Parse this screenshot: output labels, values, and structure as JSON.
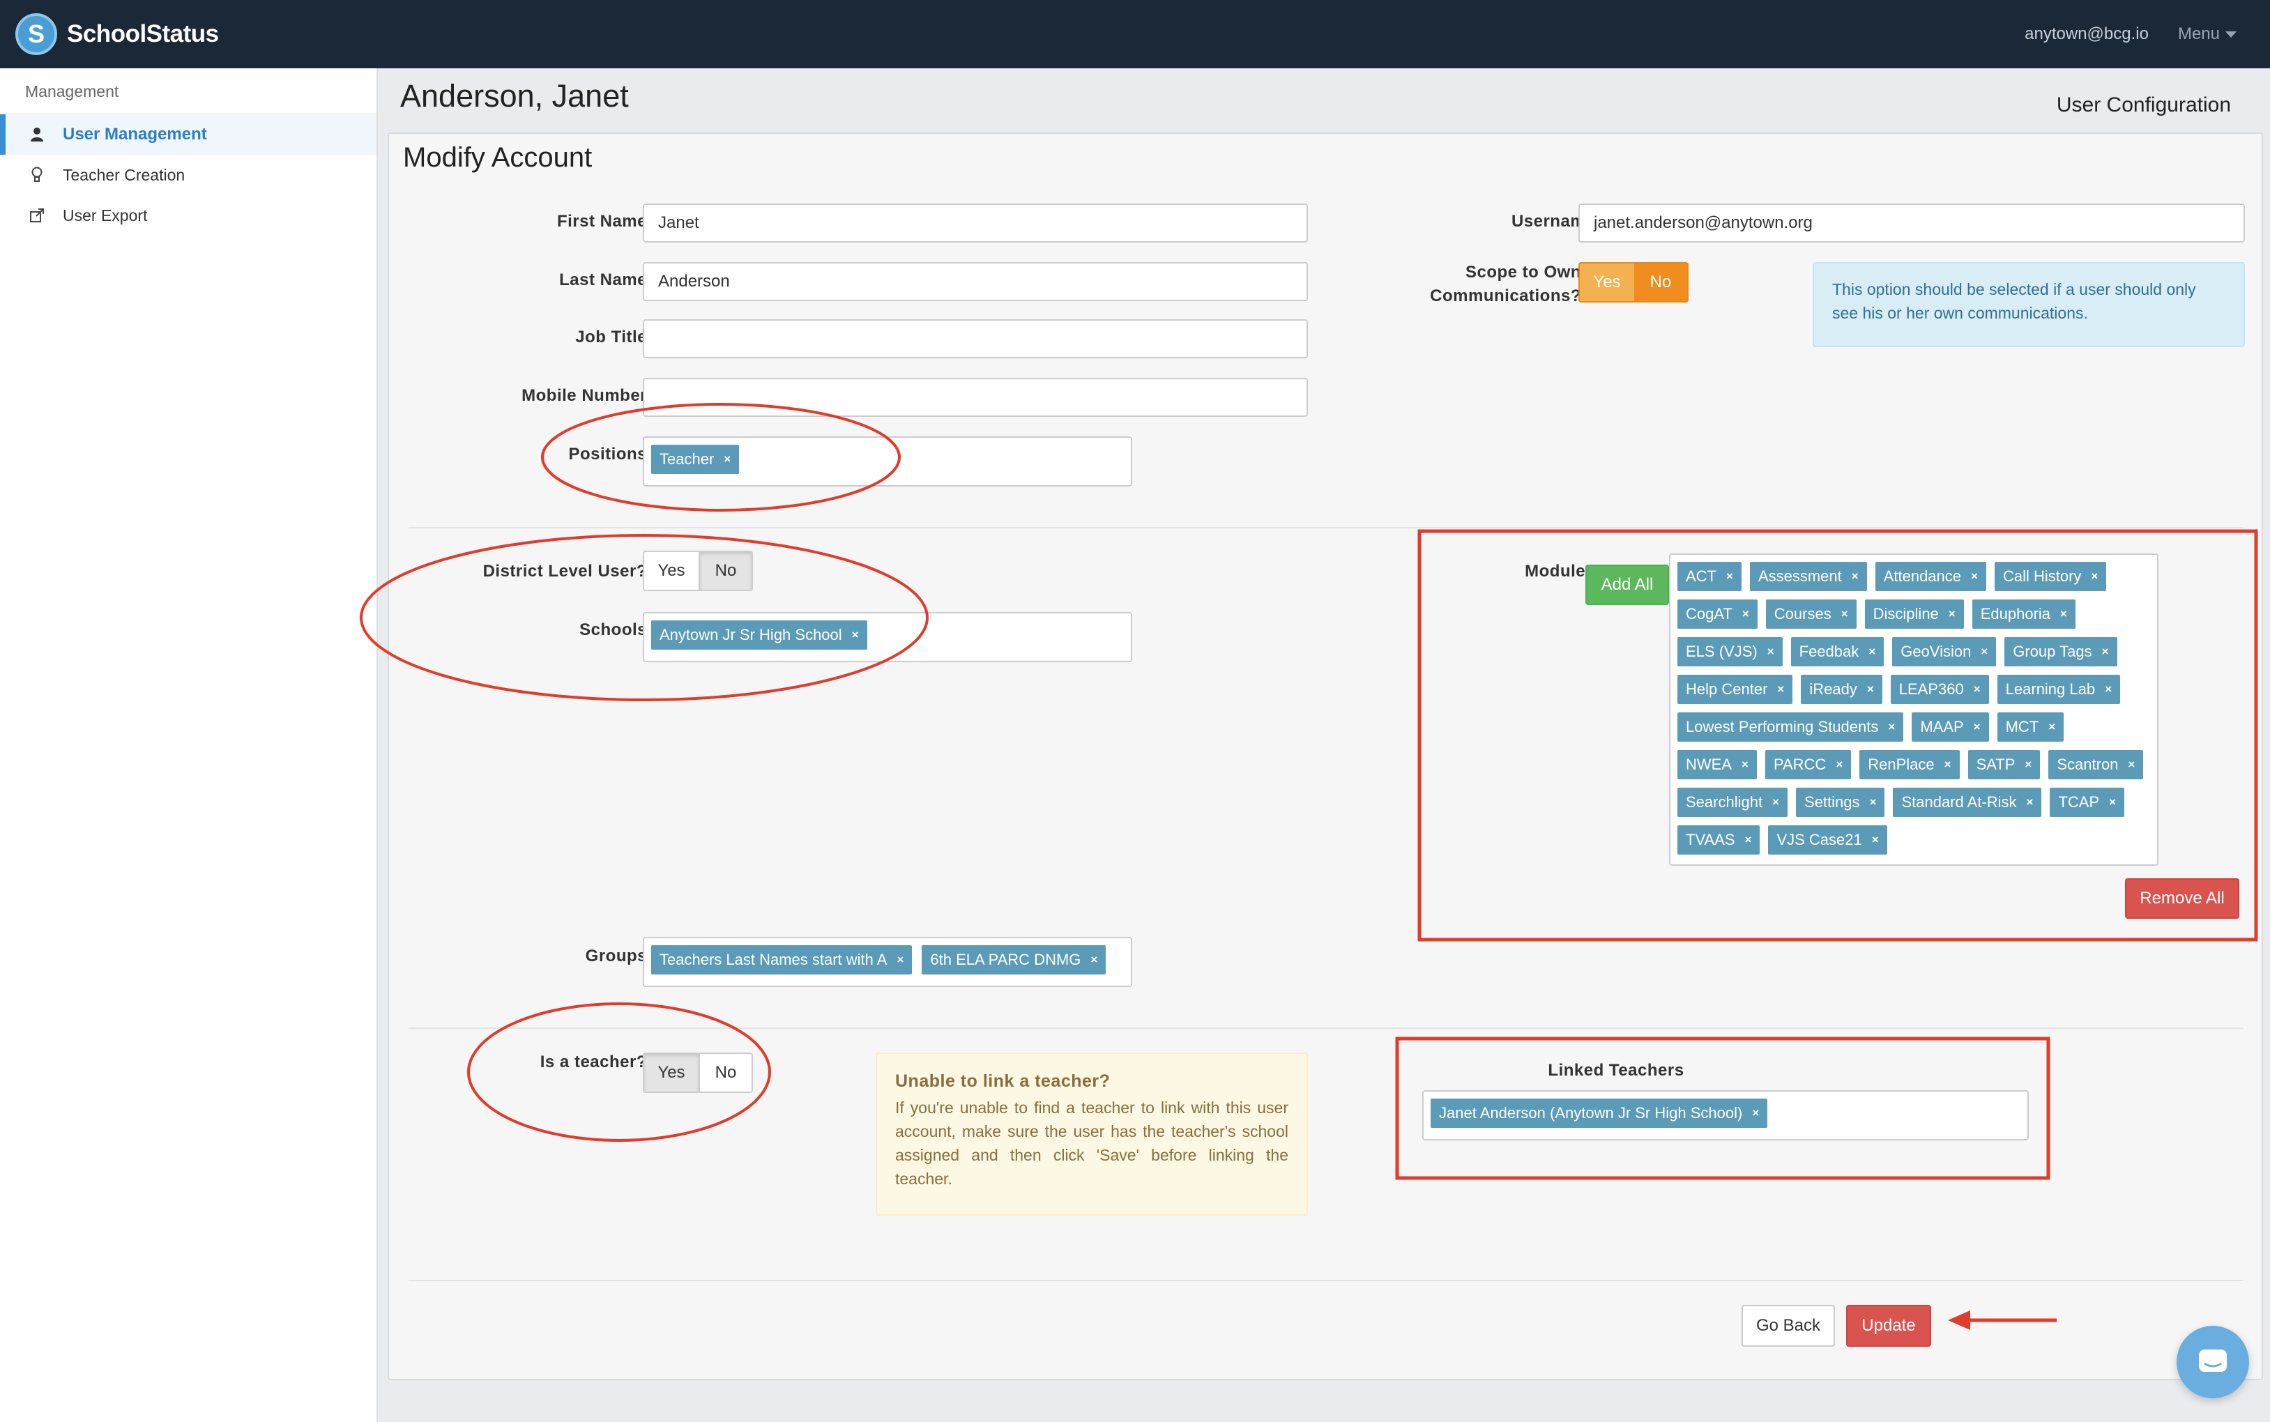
{
  "app": {
    "name": "SchoolStatus",
    "user_email": "anytown@bcg.io",
    "menu_label": "Menu"
  },
  "sidebar": {
    "section": "Management",
    "items": [
      {
        "label": "User Management",
        "icon": "user-icon",
        "active": true
      },
      {
        "label": "Teacher Creation",
        "icon": "lightbulb-icon",
        "active": false
      },
      {
        "label": "User Export",
        "icon": "external-link-icon",
        "active": false
      }
    ]
  },
  "page": {
    "title": "Anderson, Janet",
    "subtitle": "User Configuration",
    "panel_title": "Modify Account"
  },
  "form": {
    "first_name": {
      "label": "First Name",
      "value": "Janet"
    },
    "last_name": {
      "label": "Last Name",
      "value": "Anderson"
    },
    "job_title": {
      "label": "Job Title",
      "value": ""
    },
    "mobile_number": {
      "label": "Mobile Number",
      "value": ""
    },
    "positions": {
      "label": "Positions",
      "tags": [
        "Teacher"
      ]
    },
    "username": {
      "label": "Username",
      "value": "janet.anderson@anytown.org"
    },
    "scope": {
      "label_line1": "Scope to Own",
      "label_line2": "Communications?",
      "yes": "Yes",
      "no": "No",
      "selected": "No",
      "info": "This option should be selected if a user should only see his or her own communications."
    },
    "district_level": {
      "label": "District Level User?",
      "yes": "Yes",
      "no": "No",
      "selected": "No"
    },
    "schools": {
      "label": "Schools",
      "tags": [
        "Anytown Jr Sr High School"
      ]
    },
    "groups": {
      "label": "Groups",
      "tags": [
        "Teachers Last Names start with A",
        "6th ELA PARC DNMG"
      ]
    },
    "modules": {
      "label": "Modules",
      "add_all": "Add All",
      "remove_all": "Remove All",
      "tags": [
        "ACT",
        "Assessment",
        "Attendance",
        "Call History",
        "CogAT",
        "Courses",
        "Discipline",
        "Eduphoria",
        "ELS (VJS)",
        "Feedbak",
        "GeoVision",
        "Group Tags",
        "Help Center",
        "iReady",
        "LEAP360",
        "Learning Lab",
        "Lowest Performing Students",
        "MAAP",
        "MCT",
        "NWEA",
        "PARCC",
        "RenPlace",
        "SATP",
        "Scantron",
        "Searchlight",
        "Settings",
        "Standard At-Risk",
        "TCAP",
        "TVAAS",
        "VJS Case21"
      ]
    },
    "is_teacher": {
      "label": "Is a teacher?",
      "yes": "Yes",
      "no": "No",
      "selected": "Yes"
    },
    "warning": {
      "title": "Unable to link a teacher?",
      "body": "If you're unable to find a teacher to link with this user account, make sure the user has the teacher's school assigned and then click 'Save' before linking the teacher."
    },
    "linked_teachers": {
      "label": "Linked Teachers",
      "tags": [
        "Janet Anderson (Anytown Jr Sr High School)"
      ]
    }
  },
  "actions": {
    "go_back": "Go Back",
    "update": "Update"
  },
  "colors": {
    "topbar": "#1b2838",
    "accent": "#3a8fd4",
    "tag": "#5b9bb7",
    "danger": "#d9534f",
    "success": "#5cb85c",
    "annotation": "#e03c2c"
  }
}
